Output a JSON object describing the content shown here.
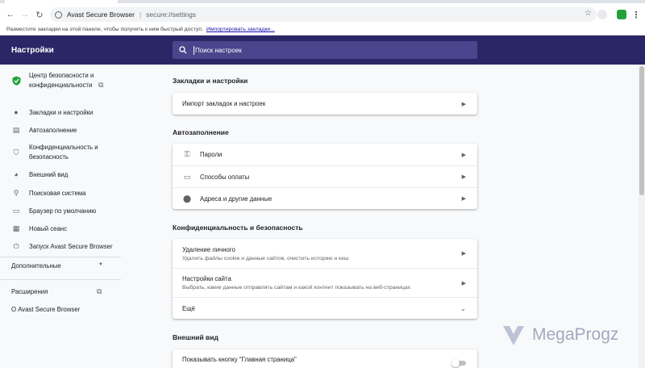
{
  "browser": {
    "site_name": "Avast Secure Browser",
    "url_path": "secure://settings",
    "bookmarks_hint": "Разместите закладки на этой панели, чтобы получить к ним быстрый доступ.",
    "bookmarks_link": "Импортировать закладки..."
  },
  "header": {
    "title": "Настройки",
    "search_placeholder": "Поиск настроек"
  },
  "sidebar": {
    "items": [
      {
        "label": "Центр безопасности и конфиденциальности",
        "icon": "avast-shield-icon"
      },
      {
        "label": "Закладки и настройки",
        "icon": "person-icon"
      },
      {
        "label": "Автозаполнение",
        "icon": "clipboard-icon"
      },
      {
        "label": "Конфиденциальность и безопасность",
        "icon": "shield-icon"
      },
      {
        "label": "Внешний вид",
        "icon": "palette-icon"
      },
      {
        "label": "Поисковая система",
        "icon": "search-icon"
      },
      {
        "label": "Браузер по умолчанию",
        "icon": "browser-icon"
      },
      {
        "label": "Новый сеанс",
        "icon": "calendar-icon"
      },
      {
        "label": "Запуск Avast Secure Browser",
        "icon": "power-icon"
      }
    ],
    "advanced": "Дополнительные",
    "extensions": "Расширения",
    "about": "О Avast Secure Browser"
  },
  "sections": {
    "bookmarks": {
      "title": "Закладки и настройки",
      "import": "Импорт закладок и настроек"
    },
    "autofill": {
      "title": "Автозаполнение",
      "passwords": "Пароли",
      "payments": "Способы оплаты",
      "addresses": "Адреса и другие данные"
    },
    "privacy": {
      "title": "Конфиденциальность и безопасность",
      "clear_title": "Удаление личного",
      "clear_sub": "Удалить файлы cookie и данные сайтов, очистить историю и кеш",
      "site_title": "Настройки сайта",
      "site_sub": "Выбрать, какие данные отправлять сайтам и какой контент показывать на веб-страницах",
      "more": "Ещё"
    },
    "appearance": {
      "title": "Внешний вид",
      "home_button": "Показывать кнопку \"Главная страница\""
    }
  },
  "watermark": "MegaProgz",
  "colors": {
    "header_bg": "#2b2766",
    "search_bg": "#4a458c",
    "shield_green": "#21a33a"
  }
}
